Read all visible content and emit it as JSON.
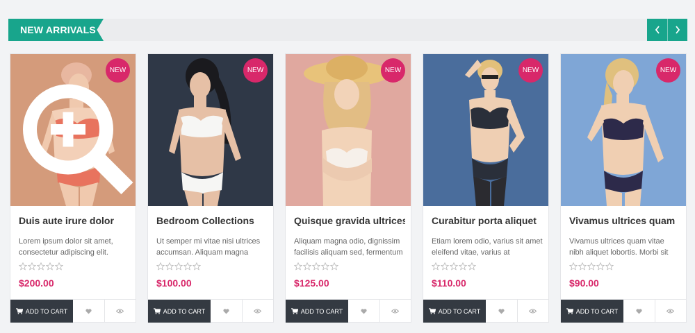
{
  "section": {
    "title": "NEW ARRIVALS"
  },
  "nav": {
    "prev_icon": "chevron-left-icon",
    "next_icon": "chevron-right-icon"
  },
  "colors": {
    "accent": "#18a58c",
    "badge": "#d8286a",
    "price": "#d8286a",
    "cart_button": "#343a42"
  },
  "products": [
    {
      "name": "Duis aute irure dolor",
      "description": "Lorem ipsum dolor sit amet, consectetur adipiscing elit.",
      "price": "$200.00",
      "badge": "NEW",
      "rating": 0,
      "add_to_cart_label": "ADD TO CART",
      "image_bg": "#d49b7b",
      "has_zoom": true
    },
    {
      "name": "Bedroom Collections",
      "description": "Ut semper mi vitae nisi ultrices accumsan. Aliquam magna",
      "price": "$100.00",
      "badge": "NEW",
      "rating": 0,
      "add_to_cart_label": "ADD TO CART",
      "image_bg": "#2f3847",
      "has_zoom": false
    },
    {
      "name": "Quisque gravida ultrices",
      "description": "Aliquam magna odio, dignissim facilisis aliquam sed, fermentum",
      "price": "$125.00",
      "badge": "NEW",
      "rating": 0,
      "add_to_cart_label": "ADD TO CART",
      "image_bg": "#e0a89f",
      "has_zoom": false
    },
    {
      "name": "Curabitur porta aliquet",
      "description": "Etiam lorem odio, varius sit amet eleifend vitae, varius at",
      "price": "$110.00",
      "badge": "NEW",
      "rating": 0,
      "add_to_cart_label": "ADD TO CART",
      "image_bg": "#4a6d9c",
      "has_zoom": false
    },
    {
      "name": "Vivamus ultrices quam",
      "description": "Vivamus ultrices quam vitae nibh aliquet lobortis. Morbi sit",
      "price": "$90.00",
      "badge": "NEW",
      "rating": 0,
      "add_to_cart_label": "ADD TO CART",
      "image_bg": "#7fa6d6",
      "has_zoom": false
    }
  ]
}
